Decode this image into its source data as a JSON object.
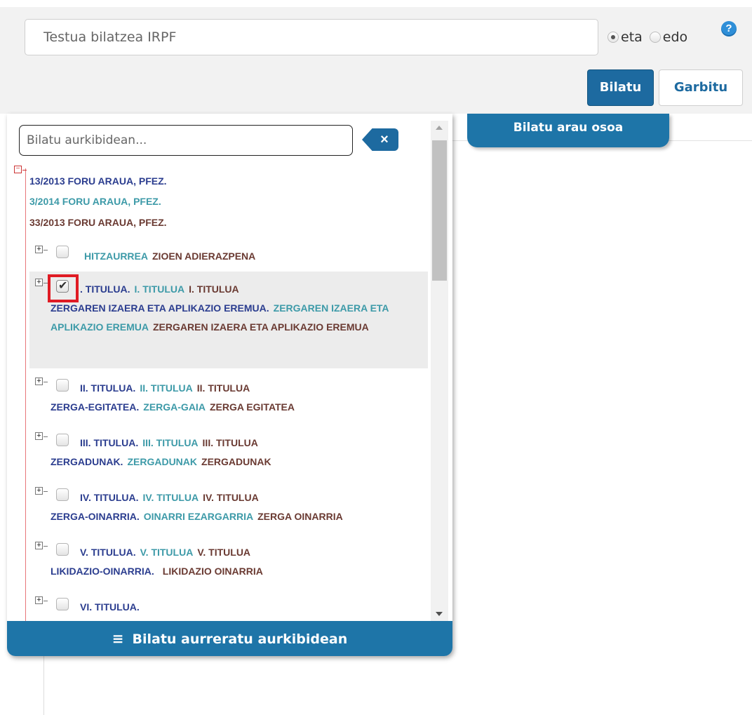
{
  "search": {
    "placeholder": "Testua bilatzea IRPF",
    "radio_eta": "eta",
    "radio_edo": "edo",
    "help": "?",
    "search_button": "Bilatu",
    "clear_button": "Garbitu"
  },
  "arau_tab": "Bilatu arau osoa",
  "panel": {
    "search_placeholder": "Bilatu aurkibidean...",
    "clear_icon": "×",
    "advanced_label": "Bilatu aurreratu aurkibidean",
    "advanced_icon": "≡"
  },
  "tree": {
    "root": [
      "13/2013 FORU ARAUA, PFEZ.",
      "3/2014 FORU ARAUA, PFEZ.",
      "33/2013 FORU ARAUA, PFEZ."
    ],
    "items": [
      {
        "line1": [
          "",
          "HITZAURREA",
          "ZIOEN ADIERAZPENA"
        ],
        "line2": []
      },
      {
        "line1": [
          ". TITULUA.",
          "I. TITULUA",
          "I. TITULUA"
        ],
        "line2": [
          "ZERGAREN IZAERA ETA APLIKAZIO EREMUA.",
          "ZERGAREN IZAERA ETA APLIKAZIO EREMUA",
          "ZERGAREN IZAERA ETA APLIKAZIO EREMUA"
        ],
        "checked": true
      },
      {
        "line1": [
          "II. TITULUA.",
          "II. TITULUA",
          "II. TITULUA"
        ],
        "line2": [
          "ZERGA-EGITATEA.",
          "ZERGA-GAIA",
          "ZERGA EGITATEA"
        ]
      },
      {
        "line1": [
          "III. TITULUA.",
          "III. TITULUA",
          "III. TITULUA"
        ],
        "line2": [
          "ZERGADUNAK.",
          "ZERGADUNAK",
          "ZERGADUNAK"
        ]
      },
      {
        "line1": [
          "IV. TITULUA.",
          "IV. TITULUA",
          "IV. TITULUA"
        ],
        "line2": [
          "ZERGA-OINARRIA.",
          "OINARRI EZARGARRIA",
          "ZERGA OINARRIA"
        ]
      },
      {
        "line1": [
          "V. TITULUA.",
          "V. TITULUA",
          "V. TITULUA"
        ],
        "line2": [
          "LIKIDAZIO-OINARRIA.",
          "",
          "LIKIDAZIO OINARRIA"
        ]
      },
      {
        "line1": [
          "VI. TITULUA.",
          "",
          ""
        ],
        "line2": []
      }
    ]
  },
  "colors": {
    "primary": "#1e75a8",
    "navy": "#2b3d8f",
    "teal": "#3d9aa8",
    "brown": "#6a3a32",
    "highlight": "#e01b24"
  }
}
